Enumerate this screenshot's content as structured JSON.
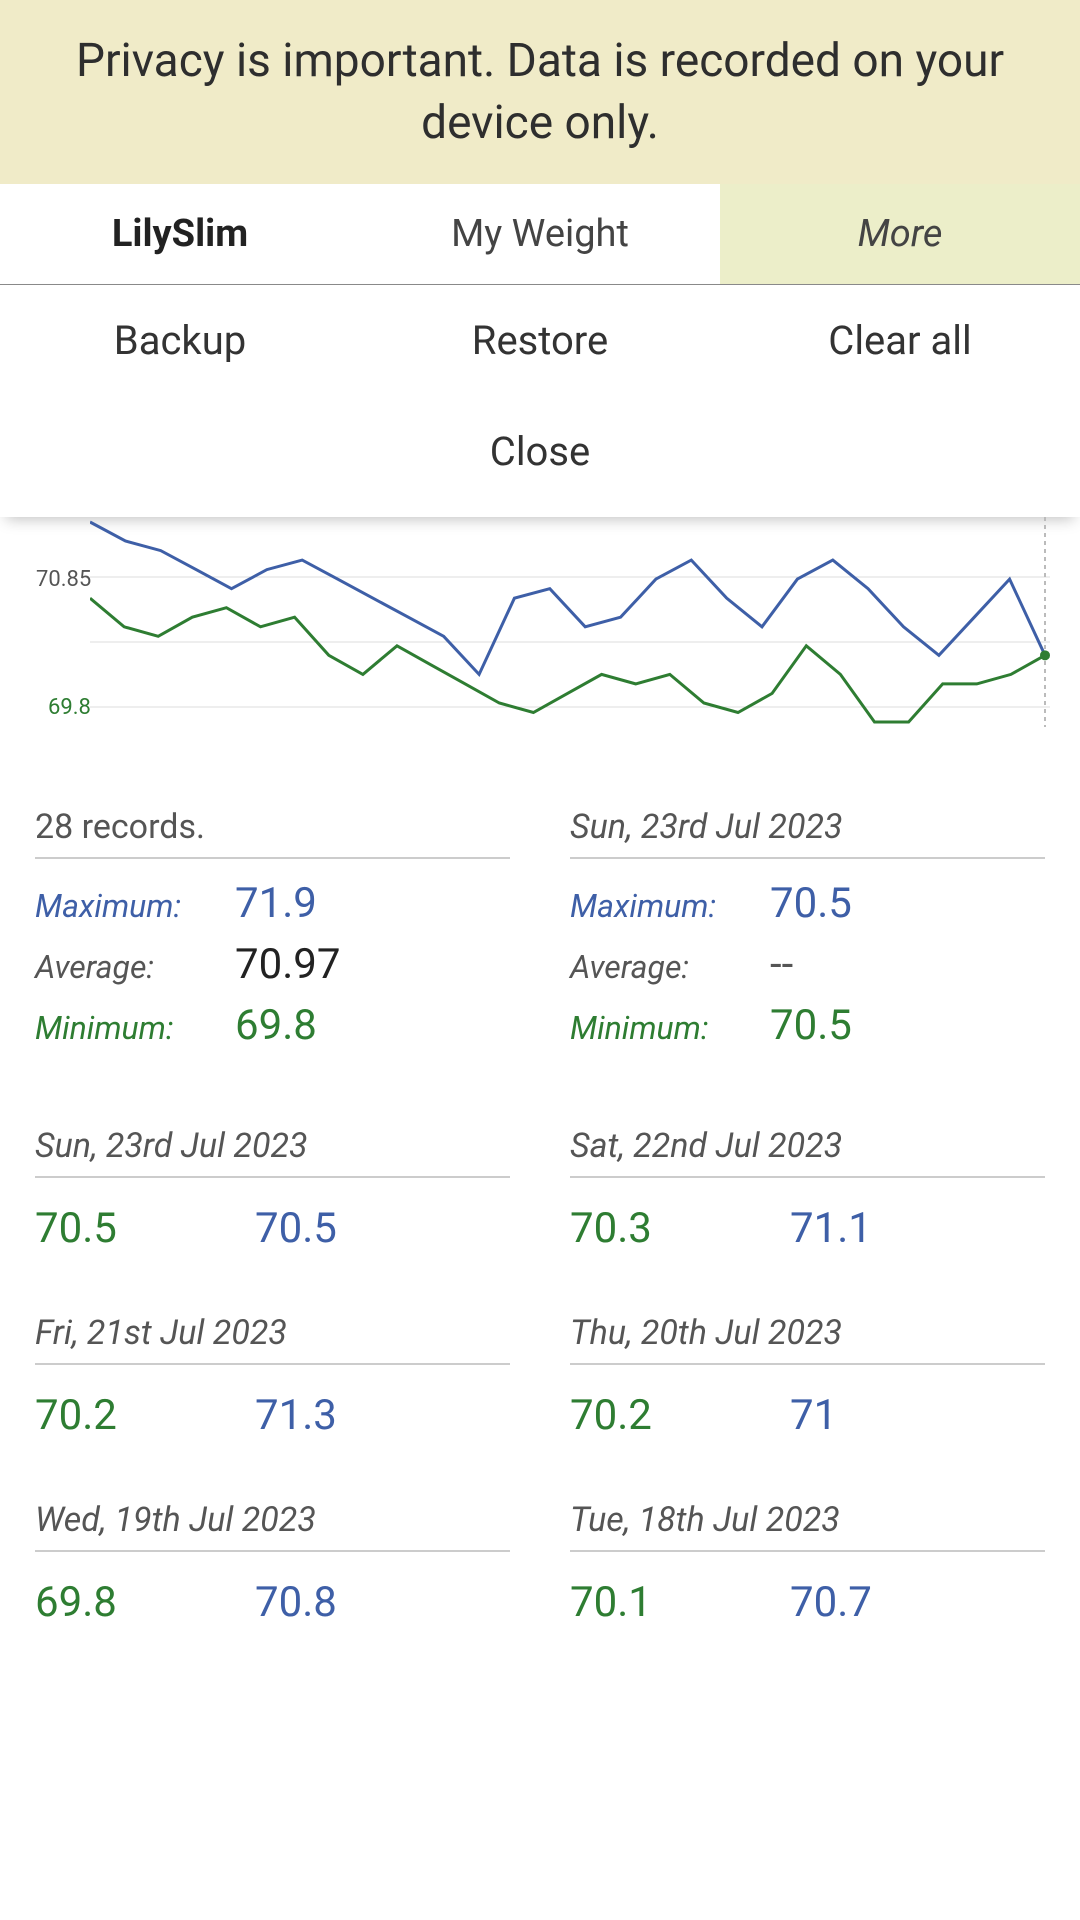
{
  "banner": {
    "text": "Privacy is important. Data is recorded on your device only."
  },
  "tabs": {
    "brand": "LilySlim",
    "myweight": "My Weight",
    "more": "More"
  },
  "menu": {
    "backup": "Backup",
    "restore": "Restore",
    "clearall": "Clear all",
    "close": "Close"
  },
  "chart_data": {
    "type": "line",
    "ylim": [
      69.8,
      71.9
    ],
    "yticks": [
      70.85,
      69.8
    ],
    "series": [
      {
        "name": "max",
        "color": "#3e5fa7",
        "values": [
          71.9,
          71.7,
          71.6,
          71.4,
          71.2,
          71.4,
          71.5,
          71.3,
          71.1,
          70.9,
          70.7,
          70.3,
          71.1,
          71.2,
          70.8,
          70.9,
          71.3,
          71.5,
          71.1,
          70.8,
          71.3,
          71.5,
          71.2,
          70.8,
          70.5,
          70.9,
          71.3,
          70.5
        ]
      },
      {
        "name": "min",
        "color": "#2e7d32",
        "values": [
          71.1,
          70.8,
          70.7,
          70.9,
          71.0,
          70.8,
          70.9,
          70.5,
          70.3,
          70.6,
          70.4,
          70.2,
          70.0,
          69.9,
          70.1,
          70.3,
          70.2,
          70.3,
          70.0,
          69.9,
          70.1,
          70.6,
          70.3,
          69.8,
          69.8,
          70.2,
          70.2,
          70.3,
          70.5
        ]
      }
    ]
  },
  "summary": {
    "left": {
      "title": "28 records.",
      "rows": [
        {
          "label": "Maximum:",
          "value": "71.9",
          "cls": "blue"
        },
        {
          "label": "Average:",
          "value": "70.97",
          "cls": "neutral"
        },
        {
          "label": "Minimum:",
          "value": "69.8",
          "cls": "green"
        }
      ]
    },
    "right": {
      "title": "Sun, 23rd Jul 2023",
      "rows": [
        {
          "label": "Maximum:",
          "value": "70.5",
          "cls": "blue"
        },
        {
          "label": "Average:",
          "value": "--",
          "cls": "gray"
        },
        {
          "label": "Minimum:",
          "value": "70.5",
          "cls": "green"
        }
      ]
    }
  },
  "records": [
    {
      "date": "Sun, 23rd Jul 2023",
      "v1": "70.5",
      "v2": "70.5"
    },
    {
      "date": "Sat, 22nd Jul 2023",
      "v1": "70.3",
      "v2": "71.1"
    },
    {
      "date": "Fri, 21st Jul 2023",
      "v1": "70.2",
      "v2": "71.3"
    },
    {
      "date": "Thu, 20th Jul 2023",
      "v1": "70.2",
      "v2": "71"
    },
    {
      "date": "Wed, 19th Jul 2023",
      "v1": "69.8",
      "v2": "70.8"
    },
    {
      "date": "Tue, 18th Jul 2023",
      "v1": "70.1",
      "v2": "70.7"
    }
  ]
}
